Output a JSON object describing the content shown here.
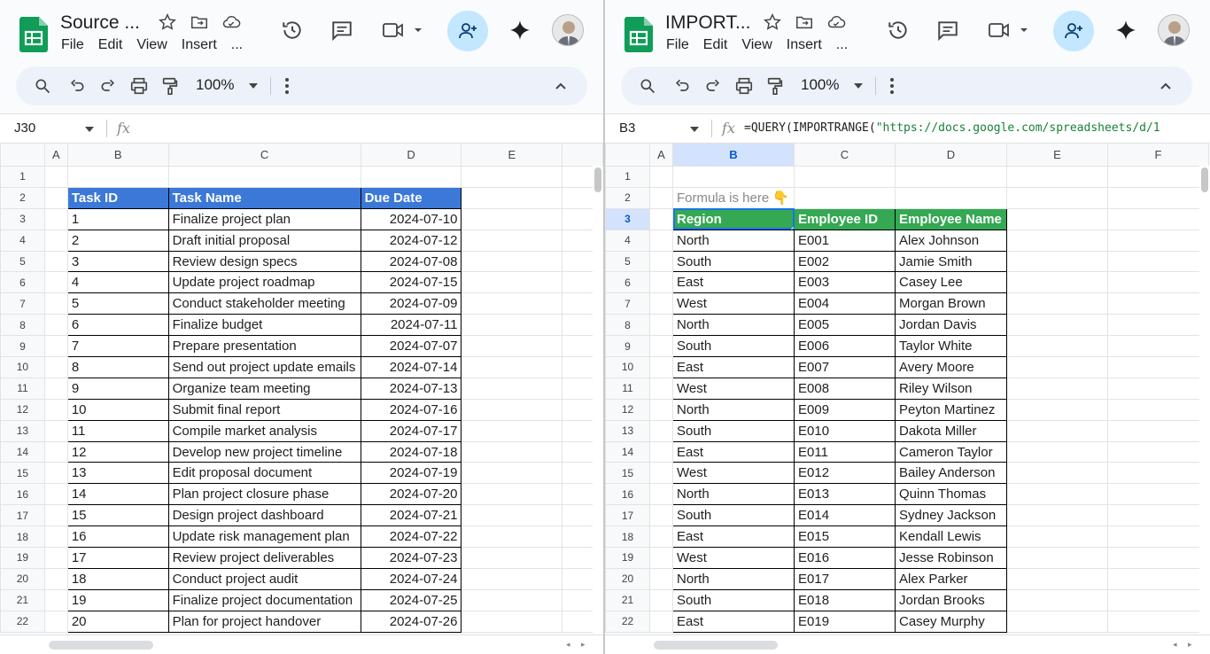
{
  "left": {
    "title": "Source ...",
    "menus": [
      "File",
      "Edit",
      "View",
      "Insert",
      "..."
    ],
    "zoom": "100%",
    "name_box": "J30",
    "formula": "",
    "columns": [
      "A",
      "B",
      "C",
      "D",
      "E"
    ],
    "rows": [
      "1",
      "2",
      "3",
      "4",
      "5",
      "6",
      "7",
      "8",
      "9",
      "10",
      "11",
      "12",
      "13",
      "14",
      "15",
      "16",
      "17",
      "18",
      "19",
      "20",
      "21",
      "22"
    ],
    "headers": [
      "Task ID",
      "Task Name",
      "Due Date"
    ],
    "data": [
      [
        "1",
        "Finalize project plan",
        "2024-07-10"
      ],
      [
        "2",
        "Draft initial proposal",
        "2024-07-12"
      ],
      [
        "3",
        "Review design specs",
        "2024-07-08"
      ],
      [
        "4",
        "Update project roadmap",
        "2024-07-15"
      ],
      [
        "5",
        "Conduct stakeholder meeting",
        "2024-07-09"
      ],
      [
        "6",
        "Finalize budget",
        "2024-07-11"
      ],
      [
        "7",
        "Prepare presentation",
        "2024-07-07"
      ],
      [
        "8",
        "Send out project update emails",
        "2024-07-14"
      ],
      [
        "9",
        "Organize team meeting",
        "2024-07-13"
      ],
      [
        "10",
        "Submit final report",
        "2024-07-16"
      ],
      [
        "11",
        "Compile market analysis",
        "2024-07-17"
      ],
      [
        "12",
        "Develop new project timeline",
        "2024-07-18"
      ],
      [
        "13",
        "Edit proposal document",
        "2024-07-19"
      ],
      [
        "14",
        "Plan project closure phase",
        "2024-07-20"
      ],
      [
        "15",
        "Design project dashboard",
        "2024-07-21"
      ],
      [
        "16",
        "Update risk management plan",
        "2024-07-22"
      ],
      [
        "17",
        "Review project deliverables",
        "2024-07-23"
      ],
      [
        "18",
        "Conduct project audit",
        "2024-07-24"
      ],
      [
        "19",
        "Finalize project documentation",
        "2024-07-25"
      ],
      [
        "20",
        "Plan for project handover",
        "2024-07-26"
      ]
    ]
  },
  "right": {
    "title": "IMPORT...",
    "menus": [
      "File",
      "Edit",
      "View",
      "Insert",
      "..."
    ],
    "zoom": "100%",
    "name_box": "B3",
    "formula_prefix": "=QUERY(IMPORTRANGE(",
    "formula_string": "\"https://docs.google.com/spreadsheets/d/1",
    "columns": [
      "A",
      "B",
      "C",
      "D",
      "E",
      "F"
    ],
    "rows": [
      "1",
      "2",
      "3",
      "4",
      "5",
      "6",
      "7",
      "8",
      "9",
      "10",
      "11",
      "12",
      "13",
      "14",
      "15",
      "16",
      "17",
      "18",
      "19",
      "20",
      "21",
      "22"
    ],
    "note": "Formula is here 👇",
    "headers": [
      "Region",
      "Employee ID",
      "Employee Name"
    ],
    "data": [
      [
        "North",
        "E001",
        "Alex Johnson"
      ],
      [
        "South",
        "E002",
        "Jamie Smith"
      ],
      [
        "East",
        "E003",
        "Casey Lee"
      ],
      [
        "West",
        "E004",
        "Morgan Brown"
      ],
      [
        "North",
        "E005",
        "Jordan Davis"
      ],
      [
        "South",
        "E006",
        "Taylor White"
      ],
      [
        "East",
        "E007",
        "Avery Moore"
      ],
      [
        "West",
        "E008",
        "Riley Wilson"
      ],
      [
        "North",
        "E009",
        "Peyton Martinez"
      ],
      [
        "South",
        "E010",
        "Dakota Miller"
      ],
      [
        "East",
        "E011",
        "Cameron Taylor"
      ],
      [
        "West",
        "E012",
        "Bailey Anderson"
      ],
      [
        "North",
        "E013",
        "Quinn Thomas"
      ],
      [
        "South",
        "E014",
        "Sydney Jackson"
      ],
      [
        "East",
        "E015",
        "Kendall Lewis"
      ],
      [
        "West",
        "E016",
        "Jesse Robinson"
      ],
      [
        "North",
        "E017",
        "Alex Parker"
      ],
      [
        "South",
        "E018",
        "Jordan Brooks"
      ],
      [
        "East",
        "E019",
        "Casey Murphy"
      ]
    ]
  },
  "icons": {
    "sheets_logo": "google-sheets-logo",
    "star": "star-icon",
    "move": "move-to-folder-icon",
    "cloud": "cloud-saved-icon",
    "history": "history-icon",
    "comment": "comment-icon",
    "meet": "video-call-icon",
    "share": "share-person-add-icon",
    "gemini": "gemini-sparkle-icon",
    "search": "search-icon",
    "undo": "undo-icon",
    "redo": "redo-icon",
    "print": "print-icon",
    "paint": "paint-format-icon",
    "more": "more-vert-icon",
    "collapse": "chevron-up-icon"
  },
  "colors": {
    "blue_header": "#3c78d8",
    "green_header": "#34a853",
    "selection": "#1a73e8",
    "toolbar_bg": "#edf2fa",
    "share_bg": "#c2e7ff"
  }
}
